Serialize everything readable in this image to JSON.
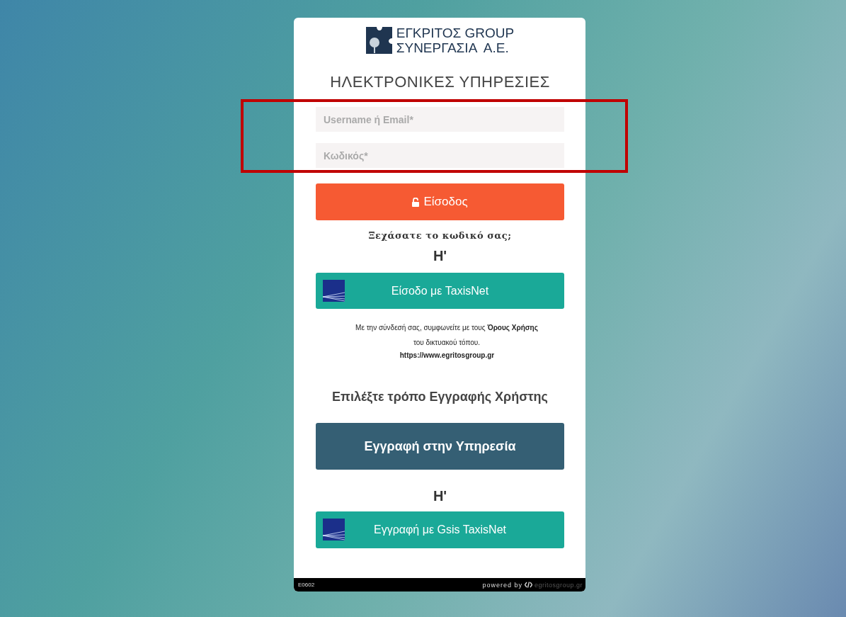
{
  "logo": {
    "line_1": "ΕΓΚΡΙΤΟΣ GROUP",
    "line_2": "ΣΥΝΕΡΓΑΣΙΑ  Α.Ε."
  },
  "title": "ΗΛΕΚΤΡΟΝΙΚΕΣ ΥΠΗΡΕΣΙΕΣ",
  "fields": [
    {
      "placeholder": "Username ή Email*"
    },
    {
      "placeholder": "Κωδικός*"
    }
  ],
  "login_button": "Είσοδος",
  "forgot_link": "Ξεχάσατε το κωδικό σας;",
  "or_1": "Η'",
  "taxisnet_login_button": "Είσοδο με TaxisNet",
  "terms": "Με την σύνδεσή σας, συμφωνείτε με τους **Όρους Χρήσης** του δικτυακού τόπου.",
  "terms_url": "https://www.egritosgroup.gr",
  "register_heading": "Επιλέξτε τρόπο Εγγραφής Χρήστης",
  "register_button": "Εγγραφή στην Υπηρεσία",
  "or_2": "Η'",
  "gsis_register_button": "Εγγραφή με Gsis TaxisNet",
  "footer": {
    "code": "E0602",
    "powered_by": "powered by",
    "site": "egritosgroup.gr"
  }
}
